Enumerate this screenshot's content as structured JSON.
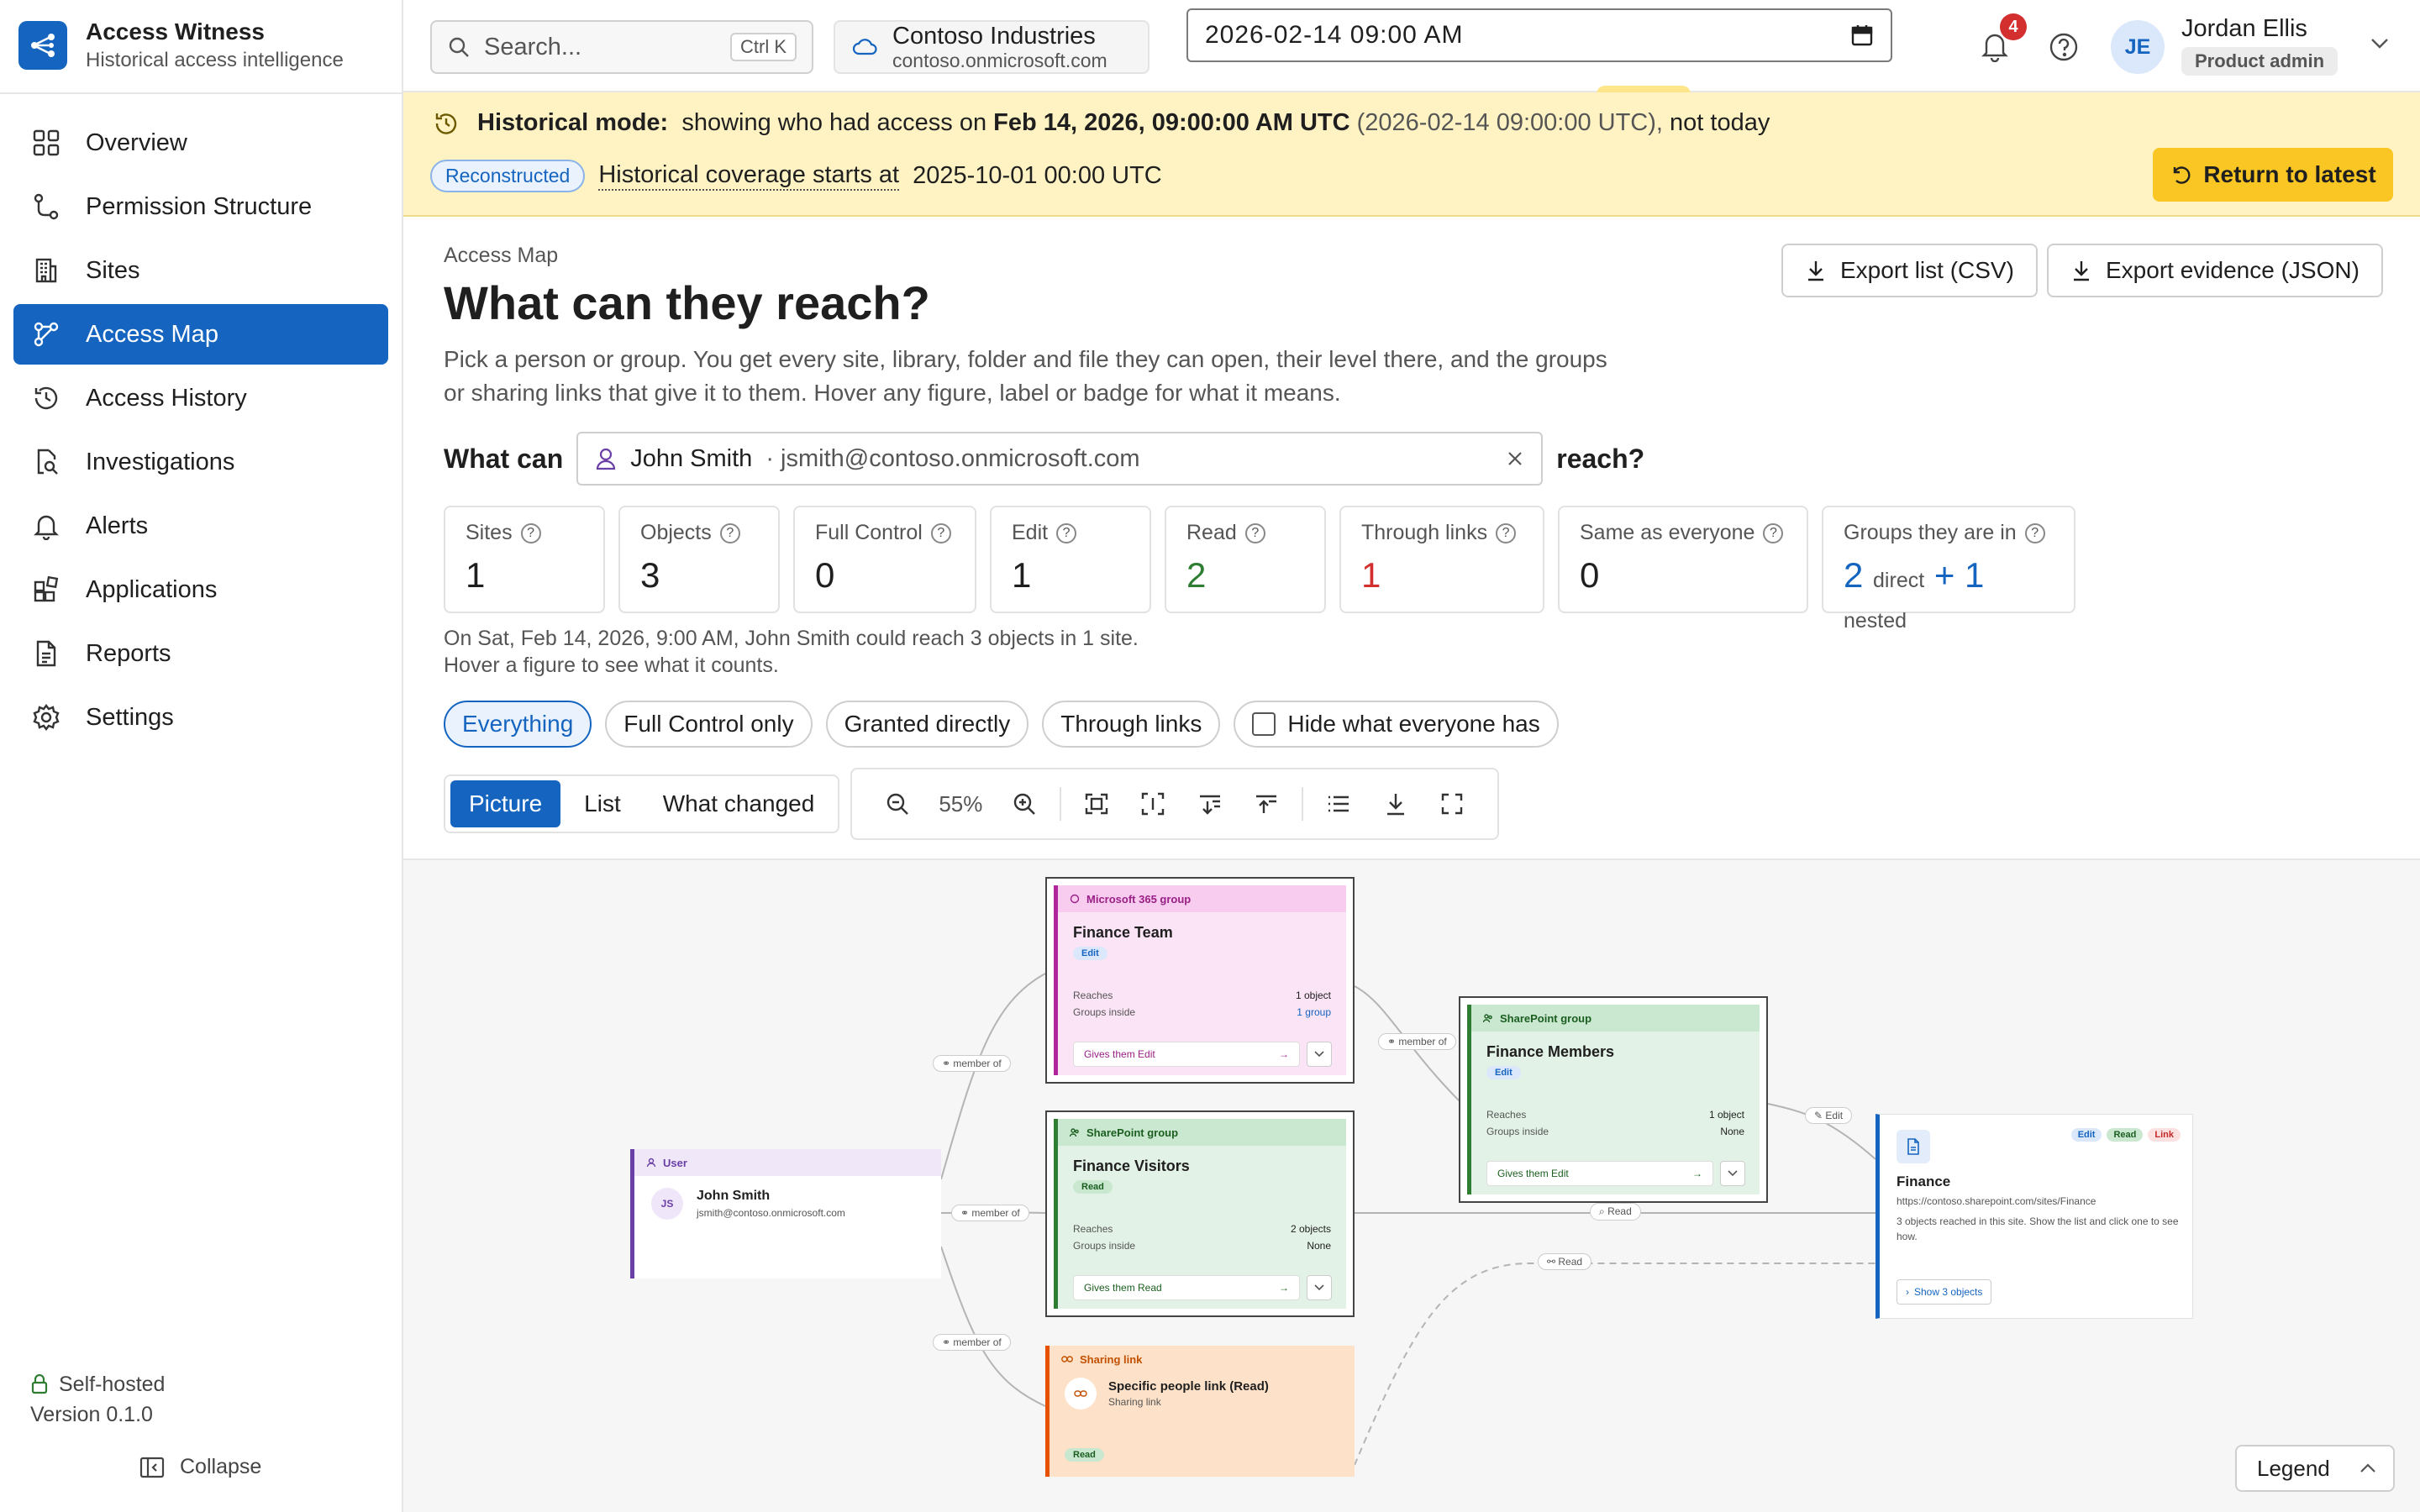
{
  "app": {
    "title": "Access Witness",
    "subtitle": "Historical access intelligence"
  },
  "sidebar": {
    "items": [
      {
        "label": "Overview",
        "icon": "grid-icon"
      },
      {
        "label": "Permission Structure",
        "icon": "hierarchy-icon"
      },
      {
        "label": "Sites",
        "icon": "building-icon"
      },
      {
        "label": "Access Map",
        "icon": "graph-icon",
        "active": true
      },
      {
        "label": "Access History",
        "icon": "history-icon"
      },
      {
        "label": "Investigations",
        "icon": "file-search-icon"
      },
      {
        "label": "Alerts",
        "icon": "bell-icon"
      },
      {
        "label": "Applications",
        "icon": "apps-icon"
      },
      {
        "label": "Reports",
        "icon": "document-icon"
      },
      {
        "label": "Settings",
        "icon": "gear-icon"
      }
    ],
    "footer": {
      "hosting": "Self-hosted",
      "version": "Version 0.1.0",
      "collapse_label": "Collapse"
    }
  },
  "topbar": {
    "search_placeholder": "Search...",
    "search_shortcut": "Ctrl K",
    "tenant_name": "Contoso Industries",
    "tenant_domain": "contoso.onmicrosoft.com",
    "datetime_value": "2026-02-14 09:00 AM",
    "notification_count": "4",
    "user_initials": "JE",
    "user_name": "Jordan Ellis",
    "user_role": "Product admin"
  },
  "banner": {
    "mode_label": "Historical mode:",
    "text_prefix": "showing who had access on",
    "date_bold": "Feb 14, 2026, 09:00:00 AM UTC",
    "date_iso": "(2026-02-14 09:00:00 UTC),",
    "text_suffix": "not today",
    "badge": "Reconstructed",
    "coverage": "Historical coverage starts at",
    "coverage_date": "2025-10-01 00:00 UTC",
    "return_label": "Return to latest",
    "accent": "#f9c623",
    "background": "#fff3c4"
  },
  "main": {
    "breadcrumb": "Access Map",
    "title": "What can they reach?",
    "intro": "Pick a person or group. You get every site, library, folder and file they can open, their level there, and the groups or sharing links that give it to them. Hover any figure, label or badge for what it means.",
    "export_csv": "Export list (CSV)",
    "export_json": "Export evidence (JSON)",
    "query_prefix": "What can",
    "query_suffix": "reach?",
    "subject_name": "John Smith",
    "subject_email": "· jsmith@contoso.onmicrosoft.com",
    "stats": [
      {
        "label": "Sites",
        "value": "1"
      },
      {
        "label": "Objects",
        "value": "3"
      },
      {
        "label": "Full Control",
        "value": "0"
      },
      {
        "label": "Edit",
        "value": "1"
      },
      {
        "label": "Read",
        "value": "2",
        "color": "green"
      },
      {
        "label": "Through links",
        "value": "1",
        "color": "red"
      },
      {
        "label": "Same as everyone",
        "value": "0"
      }
    ],
    "groups_stat": {
      "label": "Groups they are in",
      "direct": "2",
      "direct_label": "direct",
      "plus": "+",
      "nested": "1",
      "nested_label": "nested"
    },
    "summary_line1": "On Sat, Feb 14, 2026, 9:00 AM, John Smith could reach 3 objects in 1 site.",
    "summary_line2": "Hover a figure to see what it counts.",
    "filters": [
      "Everything",
      "Full Control only",
      "Granted directly",
      "Through links"
    ],
    "hide_everyone": "Hide what everyone has",
    "views": [
      "Picture",
      "List",
      "What changed"
    ],
    "zoom": "55%",
    "legend": "Legend"
  },
  "graph": {
    "user": {
      "type": "User",
      "initials": "JS",
      "name": "John Smith",
      "email": "jsmith@contoso.onmicrosoft.com"
    },
    "finance_team": {
      "type": "Microsoft 365 group",
      "name": "Finance Team",
      "level": "Edit",
      "reaches_label": "Reaches",
      "reaches": "1 object",
      "groups_label": "Groups inside",
      "groups": "1 group",
      "gives": "Gives them Edit"
    },
    "finance_visitors": {
      "type": "SharePoint group",
      "name": "Finance Visitors",
      "level": "Read",
      "reaches_label": "Reaches",
      "reaches": "2 objects",
      "groups_label": "Groups inside",
      "groups": "None",
      "gives": "Gives them Read"
    },
    "finance_members": {
      "type": "SharePoint group",
      "name": "Finance Members",
      "level": "Edit",
      "reaches_label": "Reaches",
      "reaches": "1 object",
      "groups_label": "Groups inside",
      "groups": "None",
      "gives": "Gives them Edit"
    },
    "sharing_link": {
      "type": "Sharing link",
      "name": "Specific people link (Read)",
      "sub": "Sharing link",
      "level": "Read"
    },
    "site": {
      "name": "Finance",
      "url": "https://contoso.sharepoint.com/sites/Finance",
      "desc": "3 objects reached in this site. Show the list and click one to see how.",
      "badges": [
        "Edit",
        "Read",
        "Link"
      ],
      "show": "Show 3 objects"
    },
    "edges": {
      "member_of": "member of",
      "read": "Read",
      "edit": "Edit"
    }
  }
}
